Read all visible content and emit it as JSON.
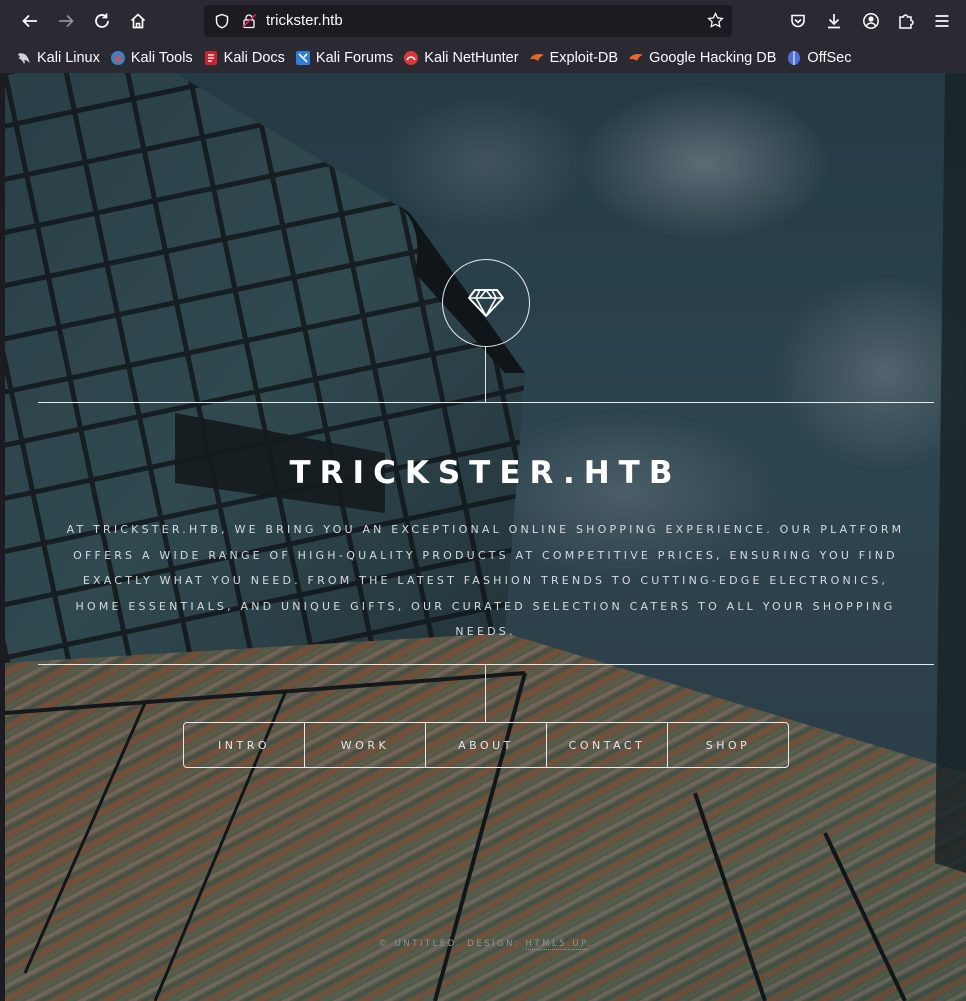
{
  "browser": {
    "url": "trickster.htb",
    "bookmarks": [
      {
        "label": "Kali Linux",
        "icon": "kali-dragon-icon"
      },
      {
        "label": "Kali Tools",
        "icon": "kali-tools-icon"
      },
      {
        "label": "Kali Docs",
        "icon": "kali-docs-icon"
      },
      {
        "label": "Kali Forums",
        "icon": "kali-forums-icon"
      },
      {
        "label": "Kali NetHunter",
        "icon": "nethunter-icon"
      },
      {
        "label": "Exploit-DB",
        "icon": "exploit-db-icon"
      },
      {
        "label": "Google Hacking DB",
        "icon": "ghdb-icon"
      },
      {
        "label": "OffSec",
        "icon": "offsec-icon"
      }
    ]
  },
  "site": {
    "logo_icon": "diamond-icon",
    "title": "TRICKSTER.HTB",
    "description": "AT TRICKSTER.HTB, WE BRING YOU AN EXCEPTIONAL ONLINE SHOPPING EXPERIENCE. OUR PLATFORM OFFERS A WIDE RANGE OF HIGH-QUALITY PRODUCTS AT COMPETITIVE PRICES, ENSURING YOU FIND EXACTLY WHAT YOU NEED. FROM THE LATEST FASHION TRENDS TO CUTTING-EDGE ELECTRONICS, HOME ESSENTIALS, AND UNIQUE GIFTS, OUR CURATED SELECTION CATERS TO ALL YOUR SHOPPING NEEDS.",
    "nav": [
      "INTRO",
      "WORK",
      "ABOUT",
      "CONTACT",
      "SHOP"
    ],
    "footer": {
      "prefix": "© UNTITLED. DESIGN: ",
      "link": "HTML5 UP",
      "suffix": "."
    }
  },
  "colors": {
    "chrome_bg": "#2b2a33",
    "urlbar_bg": "#1c1b22",
    "text_light": "#fbfbfe"
  }
}
